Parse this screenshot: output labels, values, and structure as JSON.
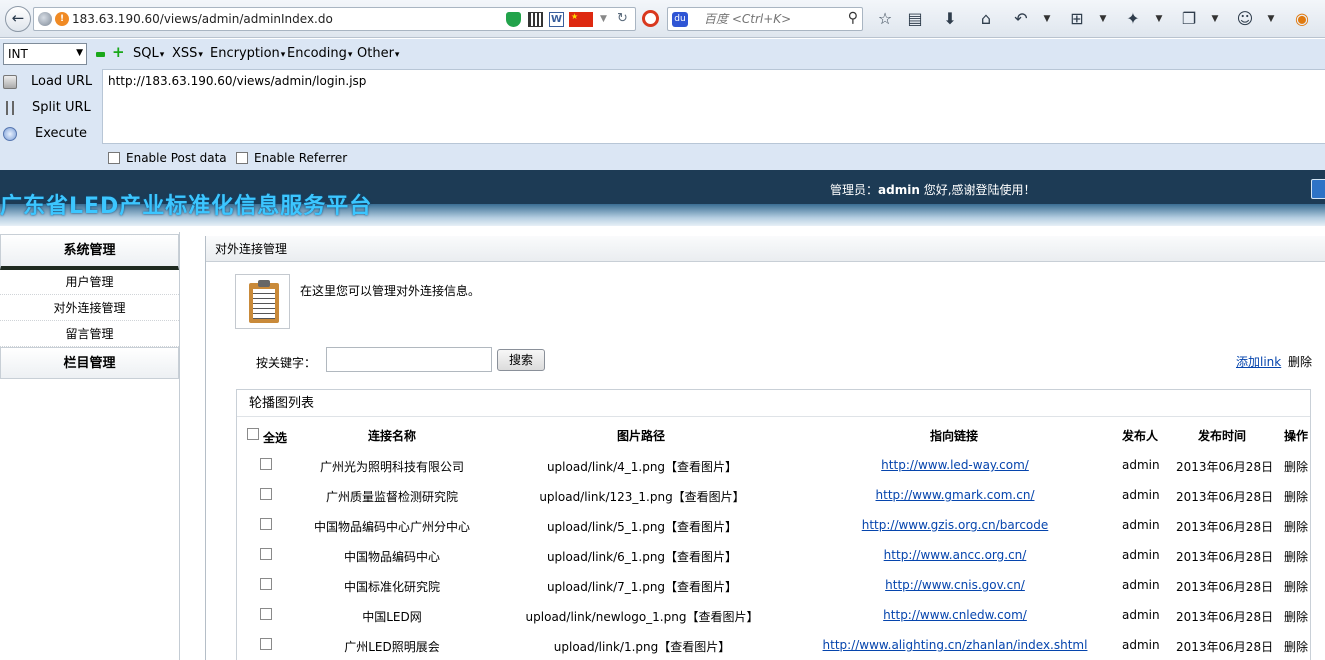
{
  "browser": {
    "url": "183.63.190.60/views/admin/adminIndex.do",
    "search_placeholder": "百度 <Ctrl+K>"
  },
  "hackbar": {
    "select_value": "INT",
    "menus": [
      "SQL",
      "XSS",
      "Encryption",
      "Encoding",
      "Other"
    ],
    "load_url": "Load URL",
    "split_url": "Split URL",
    "execute": "Execute",
    "url_text": "http://183.63.190.60/views/admin/login.jsp",
    "enable_post": "Enable Post data",
    "enable_referrer": "Enable Referrer"
  },
  "header": {
    "site_title": "广东省LED产业标准化信息服务平台",
    "admin_label": "管理员：",
    "admin_name": "admin",
    "greeting": " 您好,感谢登陆使用！"
  },
  "sidebar": {
    "section1": "系统管理",
    "items": [
      "用户管理",
      "对外连接管理",
      "留言管理"
    ],
    "section2": "栏目管理"
  },
  "main": {
    "breadcrumb": "对外连接管理",
    "intro": "在这里您可以管理对外连接信息。",
    "search_label": "按关键字：",
    "search_value": "",
    "search_button": "搜索",
    "add_link": "添加link",
    "delete": "删除",
    "list_title": "轮播图列表",
    "columns": {
      "select_all": "全选",
      "name": "连接名称",
      "path": "图片路径",
      "link": "指向链接",
      "publisher": "发布人",
      "time": "发布时间",
      "action": "操作"
    },
    "rows": [
      {
        "name": "广州光为照明科技有限公司",
        "path": "upload/link/4_1.png【查看图片】",
        "link": "http://www.led-way.com/",
        "publisher": "admin",
        "time": "2013年06月28日",
        "action": "删除"
      },
      {
        "name": "广州质量监督检测研究院",
        "path": "upload/link/123_1.png【查看图片】",
        "link": "http://www.gmark.com.cn/",
        "publisher": "admin",
        "time": "2013年06月28日",
        "action": "删除"
      },
      {
        "name": "中国物品编码中心广州分中心",
        "path": "upload/link/5_1.png【查看图片】",
        "link": "http://www.gzis.org.cn/barcode",
        "publisher": "admin",
        "time": "2013年06月28日",
        "action": "删除"
      },
      {
        "name": "中国物品编码中心",
        "path": "upload/link/6_1.png【查看图片】",
        "link": "http://www.ancc.org.cn/",
        "publisher": "admin",
        "time": "2013年06月28日",
        "action": "删除"
      },
      {
        "name": "中国标准化研究院",
        "path": "upload/link/7_1.png【查看图片】",
        "link": "http://www.cnis.gov.cn/",
        "publisher": "admin",
        "time": "2013年06月28日",
        "action": "删除"
      },
      {
        "name": "中国LED网",
        "path": "upload/link/newlogo_1.png【查看图片】",
        "link": "http://www.cnledw.com/",
        "publisher": "admin",
        "time": "2013年06月28日",
        "action": "删除"
      },
      {
        "name": "广州LED照明展会",
        "path": "upload/link/1.png【查看图片】",
        "link": "http://www.alighting.cn/zhanlan/index.shtml",
        "publisher": "admin",
        "time": "2013年06月28日",
        "action": "删除"
      }
    ]
  }
}
